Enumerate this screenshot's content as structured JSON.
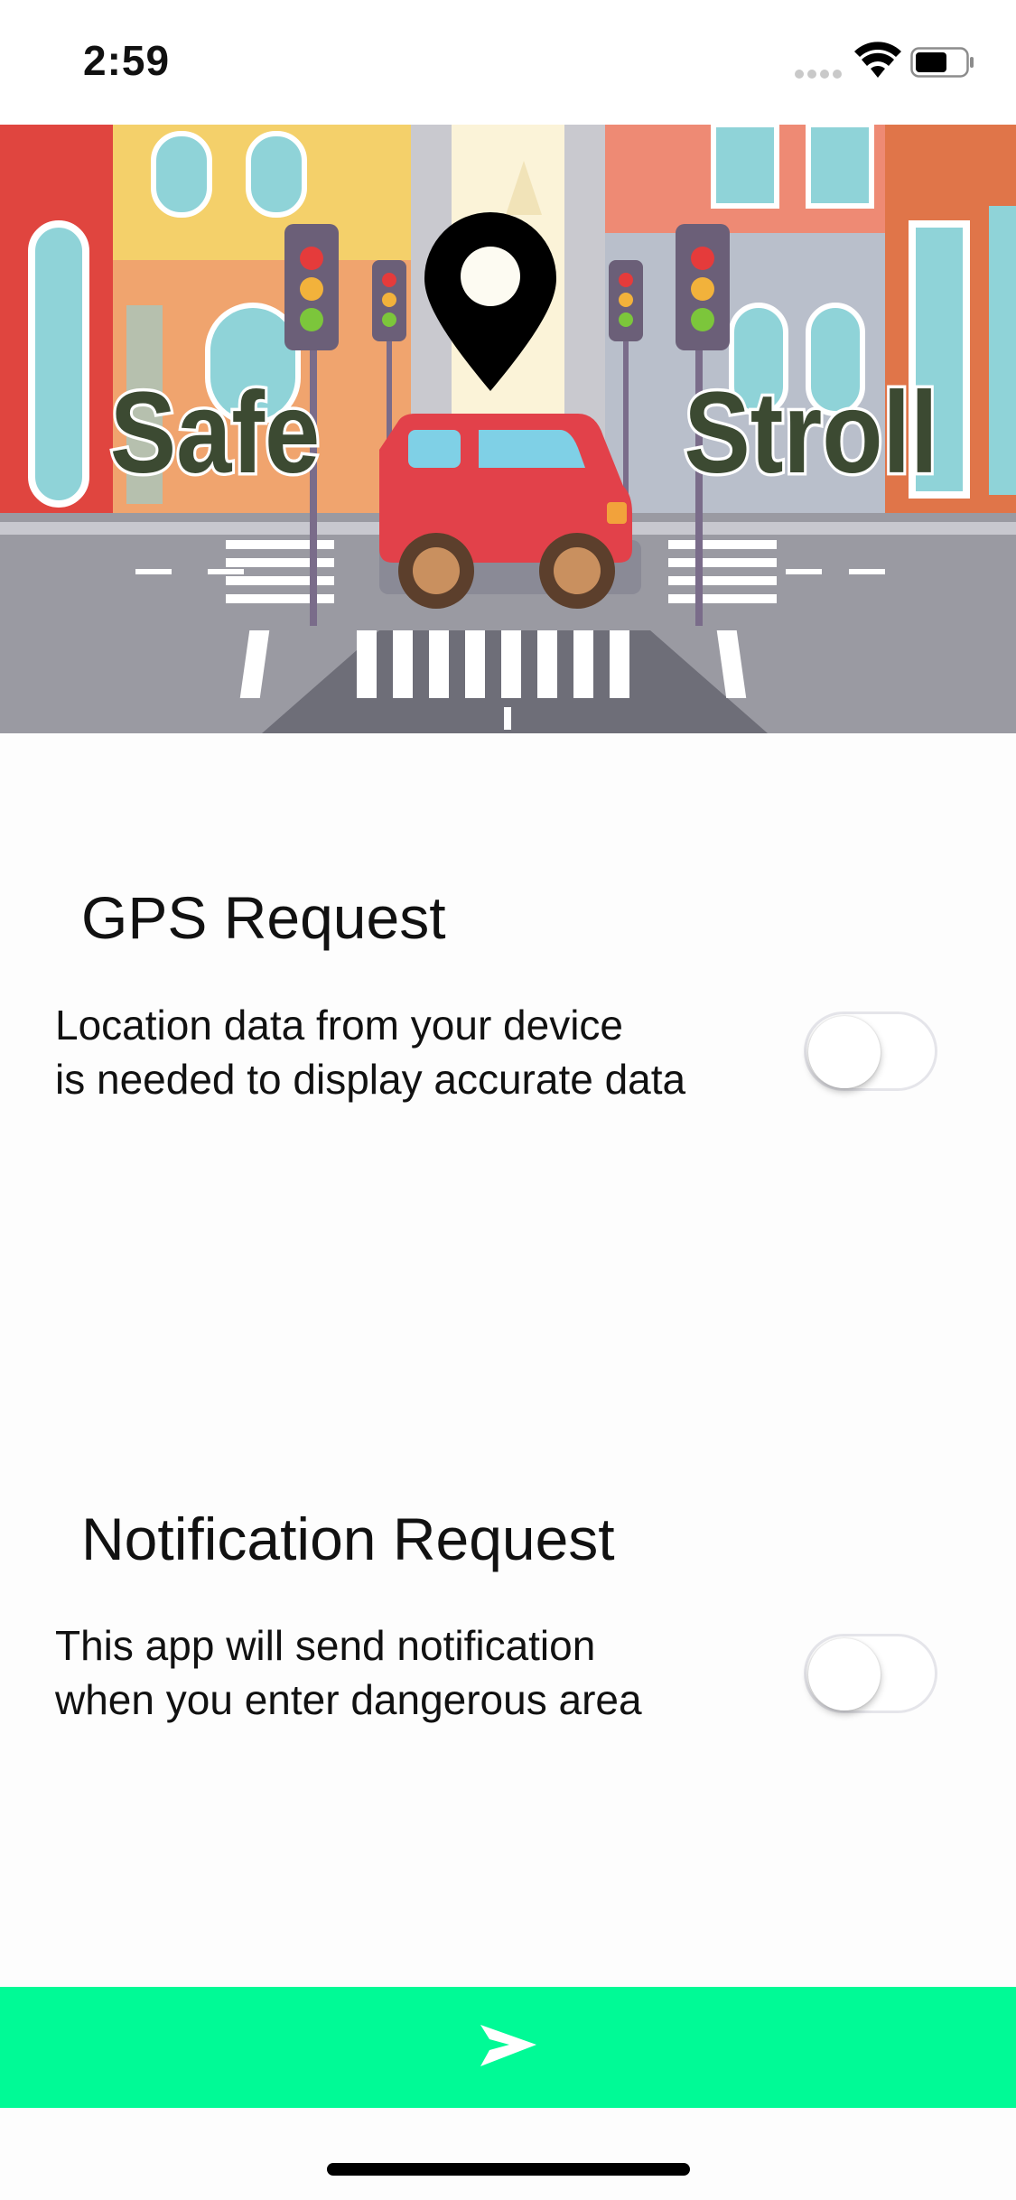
{
  "status_bar": {
    "time": "2:59"
  },
  "hero": {
    "title_left": "Safe",
    "title_right": "Stroll",
    "colors": {
      "logo_text": "#3c4a32",
      "car": "#e2414a",
      "sky": "#fbf3d8"
    }
  },
  "gps": {
    "title": "GPS Request",
    "description_line1": "Location data from your device",
    "description_line2": "is needed to display accurate data",
    "toggle_on": false
  },
  "notification": {
    "title": "Notification Request",
    "description_line1": "This app will send notification",
    "description_line2": "when you enter dangerous area",
    "toggle_on": false
  },
  "footer": {
    "next_icon": "arrow-right-icon",
    "accent_color": "#00fa96"
  }
}
